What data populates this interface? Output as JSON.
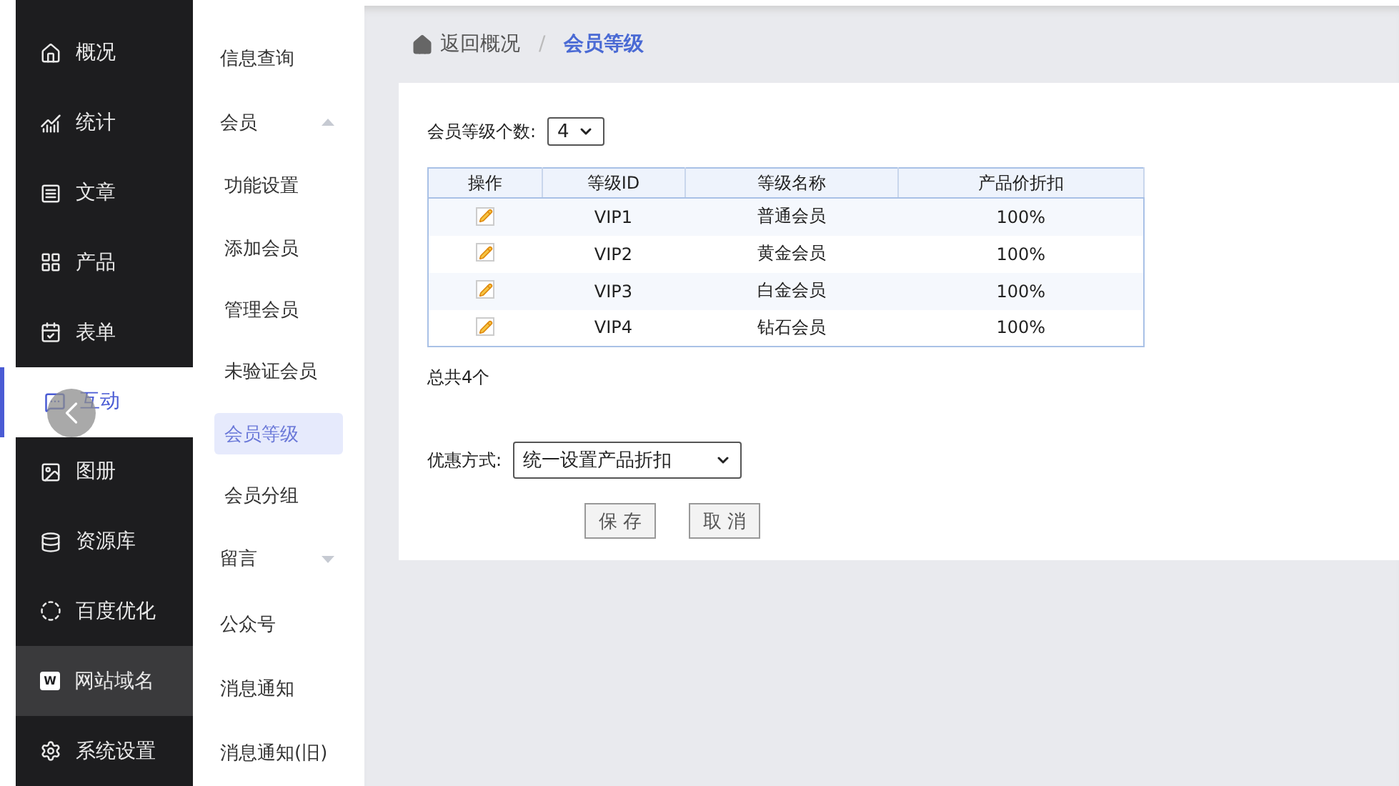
{
  "nav": [
    {
      "label": "概况",
      "selected": false,
      "hovered": false
    },
    {
      "label": "统计",
      "selected": false,
      "hovered": false
    },
    {
      "label": "文章",
      "selected": false,
      "hovered": false
    },
    {
      "label": "产品",
      "selected": false,
      "hovered": false
    },
    {
      "label": "表单",
      "selected": false,
      "hovered": false
    },
    {
      "label": "互动",
      "selected": true,
      "hovered": false
    },
    {
      "label": "图册",
      "selected": false,
      "hovered": false
    },
    {
      "label": "资源库",
      "selected": false,
      "hovered": false
    },
    {
      "label": "百度优化",
      "selected": false,
      "hovered": false
    },
    {
      "label": "网站域名",
      "selected": false,
      "hovered": true,
      "badge": "W"
    },
    {
      "label": "系统设置",
      "selected": false,
      "hovered": false
    }
  ],
  "submenu": [
    {
      "kind": "item",
      "label": "信息查询",
      "selected": false
    },
    {
      "kind": "group",
      "label": "会员",
      "expanded": true,
      "children": [
        {
          "label": "功能设置",
          "selected": false
        },
        {
          "label": "添加会员",
          "selected": false
        },
        {
          "label": "管理会员",
          "selected": false
        },
        {
          "label": "未验证会员",
          "selected": false
        },
        {
          "label": "会员等级",
          "selected": true
        },
        {
          "label": "会员分组",
          "selected": false
        }
      ]
    },
    {
      "kind": "group",
      "label": "留言",
      "expanded": false
    },
    {
      "kind": "item",
      "label": "公众号",
      "selected": false
    },
    {
      "kind": "item",
      "label": "消息通知",
      "selected": false
    },
    {
      "kind": "item",
      "label": "消息通知(旧)",
      "selected": false
    }
  ],
  "breadcrumb": {
    "back": "返回概况",
    "separator": "/",
    "current": "会员等级"
  },
  "level_count": {
    "label": "会员等级个数:",
    "value": "4"
  },
  "table": {
    "columns": [
      "操作",
      "等级ID",
      "等级名称",
      "产品价折扣"
    ],
    "rows": [
      {
        "id": "VIP1",
        "name": "普通会员",
        "discount": "100%"
      },
      {
        "id": "VIP2",
        "name": "黄金会员",
        "discount": "100%"
      },
      {
        "id": "VIP3",
        "name": "白金会员",
        "discount": "100%"
      },
      {
        "id": "VIP4",
        "name": "钻石会员",
        "discount": "100%"
      }
    ]
  },
  "total": "总共4个",
  "discount_mode": {
    "label": "优惠方式:",
    "value": "统一设置产品折扣"
  },
  "buttons": [
    "保 存",
    "取 消"
  ]
}
